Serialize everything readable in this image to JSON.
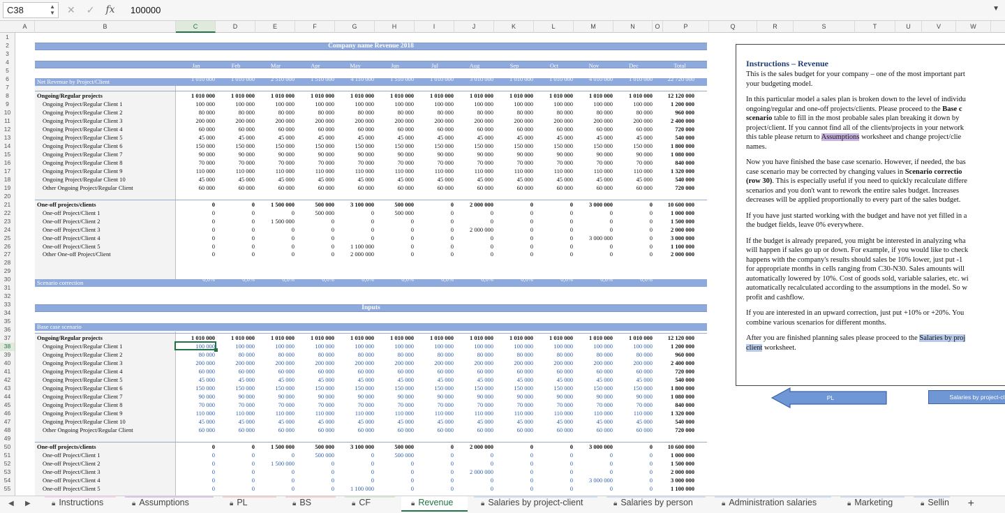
{
  "formula_bar": {
    "cell_ref": "C38",
    "fx": "fx",
    "value": "100000"
  },
  "columns": [
    "A",
    "B",
    "C",
    "D",
    "E",
    "F",
    "G",
    "H",
    "I",
    "J",
    "K",
    "L",
    "M",
    "N",
    "O",
    "P",
    "Q",
    "R",
    "S",
    "T",
    "U",
    "V",
    "W"
  ],
  "selected_column": "C",
  "selected_row": "38",
  "report": {
    "title": "Company name Revenue 2018",
    "months": [
      "Jan",
      "Feb",
      "Mar",
      "Apr",
      "May",
      "Jun",
      "Jul",
      "Aug",
      "Sep",
      "Oct",
      "Nov",
      "Dec",
      "Total"
    ],
    "net_label": "Net Revenue by Project/Client",
    "net_values": [
      "1 010 000",
      "1 010 000",
      "2 510 000",
      "1 510 000",
      "4 110 000",
      "1 510 000",
      "1 010 000",
      "3 010 000",
      "1 010 000",
      "1 010 000",
      "4 010 000",
      "1 010 000",
      "22 720 000"
    ],
    "ongoing": {
      "label": "Ongoing/Regular projects",
      "values": [
        "1 010 000",
        "1 010 000",
        "1 010 000",
        "1 010 000",
        "1 010 000",
        "1 010 000",
        "1 010 000",
        "1 010 000",
        "1 010 000",
        "1 010 000",
        "1 010 000",
        "1 010 000",
        "12 120 000"
      ]
    },
    "ongoing_rows": [
      {
        "label": "Ongoing Project/Regular Client 1",
        "v": "100 000",
        "t": "1 200 000"
      },
      {
        "label": "Ongoing Project/Regular Client 2",
        "v": "80 000",
        "t": "960 000"
      },
      {
        "label": "Ongoing Project/Regular Client 3",
        "v": "200 000",
        "t": "2 400 000"
      },
      {
        "label": "Ongoing Project/Regular Client 4",
        "v": "60 000",
        "t": "720 000"
      },
      {
        "label": "Ongoing Project/Regular Client 5",
        "v": "45 000",
        "t": "540 000"
      },
      {
        "label": "Ongoing Project/Regular Client 6",
        "v": "150 000",
        "t": "1 800 000"
      },
      {
        "label": "Ongoing Project/Regular Client 7",
        "v": "90 000",
        "t": "1 080 000"
      },
      {
        "label": "Ongoing Project/Regular Client 8",
        "v": "70 000",
        "t": "840 000"
      },
      {
        "label": "Ongoing Project/Regular Client 9",
        "v": "110 000",
        "t": "1 320 000"
      },
      {
        "label": "Ongoing Project/Regular Client 10",
        "v": "45 000",
        "t": "540 000"
      },
      {
        "label": "Other Ongoing Project/Regular Client",
        "v": "60 000",
        "t": "720 000"
      }
    ],
    "oneoff": {
      "label": "One-off projects/clients",
      "values": [
        "0",
        "0",
        "1 500 000",
        "500 000",
        "3 100 000",
        "500 000",
        "0",
        "2 000 000",
        "0",
        "0",
        "3 000 000",
        "0",
        "10 600 000"
      ]
    },
    "oneoff_rows": [
      {
        "label": "One-off Project/Client 1",
        "values": [
          "0",
          "0",
          "0",
          "500 000",
          "0",
          "500 000",
          "0",
          "0",
          "0",
          "0",
          "0",
          "0",
          "1 000 000"
        ]
      },
      {
        "label": "One-off Project/Client 2",
        "values": [
          "0",
          "0",
          "1 500 000",
          "0",
          "0",
          "0",
          "0",
          "0",
          "0",
          "0",
          "0",
          "0",
          "1 500 000"
        ]
      },
      {
        "label": "One-off Project/Client 3",
        "values": [
          "0",
          "0",
          "0",
          "0",
          "0",
          "0",
          "0",
          "2 000 000",
          "0",
          "0",
          "0",
          "0",
          "2 000 000"
        ]
      },
      {
        "label": "One-off Project/Client 4",
        "values": [
          "0",
          "0",
          "0",
          "0",
          "0",
          "0",
          "0",
          "0",
          "0",
          "0",
          "3 000 000",
          "0",
          "3 000 000"
        ]
      },
      {
        "label": "One-off Project/Client 5",
        "values": [
          "0",
          "0",
          "0",
          "0",
          "1 100 000",
          "0",
          "0",
          "0",
          "0",
          "0",
          "0",
          "0",
          "1 100 000"
        ]
      },
      {
        "label": "Other One-off Project/Client",
        "values": [
          "0",
          "0",
          "0",
          "0",
          "2 000 000",
          "0",
          "0",
          "0",
          "0",
          "0",
          "0",
          "0",
          "2 000 000"
        ]
      }
    ],
    "scenario_label": "Scenario correction",
    "scenario_value": "0,0%",
    "inputs_title": "Inputs",
    "base_label": "Base case scenario"
  },
  "instructions": {
    "title": "Instructions – Revenue",
    "p1": [
      "This is the sales budget for your company – one of the most important part",
      "your budgeting model."
    ],
    "p2": [
      "In this particular model a sales plan is broken down to the level of individu",
      "ongoing/regular and one-off projects/clients. Please proceed to the Base c",
      "scenario table to fill in the most probable sales plan breaking it down by",
      "project/client. If you cannot find all of the clients/projects in your network",
      "this table please return to Assumptions worksheet and change project/clie",
      "names."
    ],
    "p3": [
      "Now you have finished the base case scenario. However, if needed, the bas",
      "case scenario may be corrected by changing values in Scenario correctio",
      "(row 30). This is especially useful if you need to quickly recalculate differe",
      "scenarios and you don't want to rework the entire sales budget. Increases",
      "decreases will be applied proportionally to every part of the sales budget."
    ],
    "p4": [
      "If you have just started working with the budget and have not yet filled in a",
      "the budget fields, leave 0% everywhere."
    ],
    "p5": [
      "If the budget is already prepared, you might be interested in analyzing wha",
      "will happen if sales go up or down. For example, if you would like to check",
      "happens with the company's results should sales be 10% lower, just put -1",
      "for appropriate months in cells ranging from C30-N30. Sales amounts will",
      "automatically lowered by 10%. Cost of goods sold, variable salaries, etc. wi",
      "automatically recalculated according to the assumptions in the model. So w",
      "profit and cashflow."
    ],
    "p6": [
      "If you are interested in an upward correction, just put +10% or +20%. You",
      "combine various scenarios for different months."
    ],
    "p7": [
      "After you are finished planning sales please proceed to the Salaries by proj",
      "client worksheet."
    ],
    "btn_pl": "PL",
    "btn_salaries": "Salaries by project-cl"
  },
  "tabs": [
    {
      "label": "Instructions",
      "color": "#f4d7ea"
    },
    {
      "label": "Assumptions",
      "color": "#d9c8ec"
    },
    {
      "label": "PL",
      "color": "#f6cfcf"
    },
    {
      "label": "BS",
      "color": "#f6cfcf"
    },
    {
      "label": "CF",
      "color": "#d6ecd0"
    },
    {
      "label": "Revenue",
      "color": "#ffffff"
    },
    {
      "label": "Salaries by project-client",
      "color": "#cfe0f4"
    },
    {
      "label": "Salaries by person",
      "color": "#cfe0f4"
    },
    {
      "label": "Administration salaries",
      "color": "#cfe0f4"
    },
    {
      "label": "Marketing",
      "color": "#cfe0f4"
    },
    {
      "label": "Sellin",
      "color": "#cfe0f4"
    }
  ],
  "add_tab": "+"
}
